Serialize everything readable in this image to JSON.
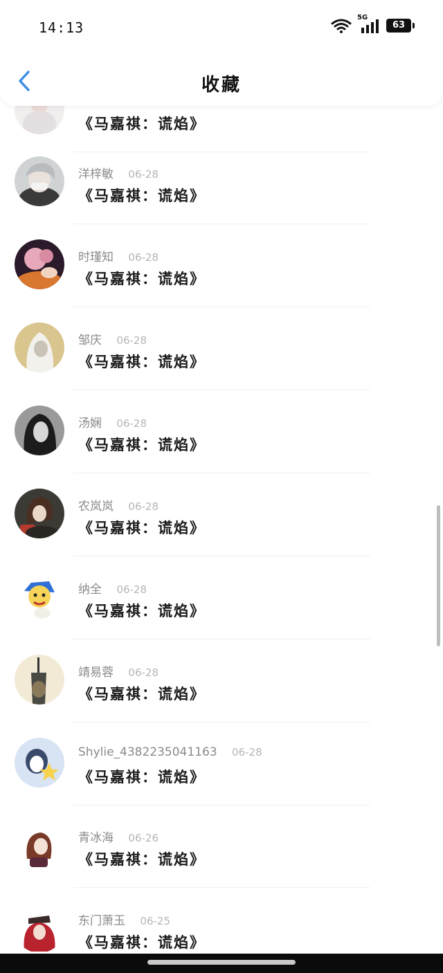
{
  "status_bar": {
    "time": "14:13",
    "network": "5G",
    "battery": "63"
  },
  "header": {
    "title": "收藏",
    "back_icon": "chevron-left-icon"
  },
  "items": [
    {
      "name": "",
      "date": "",
      "title": "《马嘉祺：谎焰》"
    },
    {
      "name": "洋梓敏",
      "date": "06-28",
      "title": "《马嘉祺：谎焰》"
    },
    {
      "name": "时瑾知",
      "date": "06-28",
      "title": "《马嘉祺：谎焰》"
    },
    {
      "name": "邹庆",
      "date": "06-28",
      "title": "《马嘉祺：谎焰》"
    },
    {
      "name": "汤娴",
      "date": "06-28",
      "title": "《马嘉祺：谎焰》"
    },
    {
      "name": "农岚岚",
      "date": "06-28",
      "title": "《马嘉祺：谎焰》"
    },
    {
      "name": "纳全",
      "date": "06-28",
      "title": "《马嘉祺：谎焰》"
    },
    {
      "name": "靖易蓉",
      "date": "06-28",
      "title": "《马嘉祺：谎焰》"
    },
    {
      "name": "Shylie_4382235041163",
      "date": "06-28",
      "title": "《马嘉祺：谎焰》"
    },
    {
      "name": "青冰海",
      "date": "06-26",
      "title": "《马嘉祺：谎焰》"
    },
    {
      "name": "东门萧玉",
      "date": "06-25",
      "title": "《马嘉祺：谎焰》"
    }
  ],
  "colors": {
    "accent": "#3b8fe6",
    "name_text": "#8a8a8a",
    "date_text": "#b5b5b5",
    "title_text": "#1a1a1a"
  }
}
